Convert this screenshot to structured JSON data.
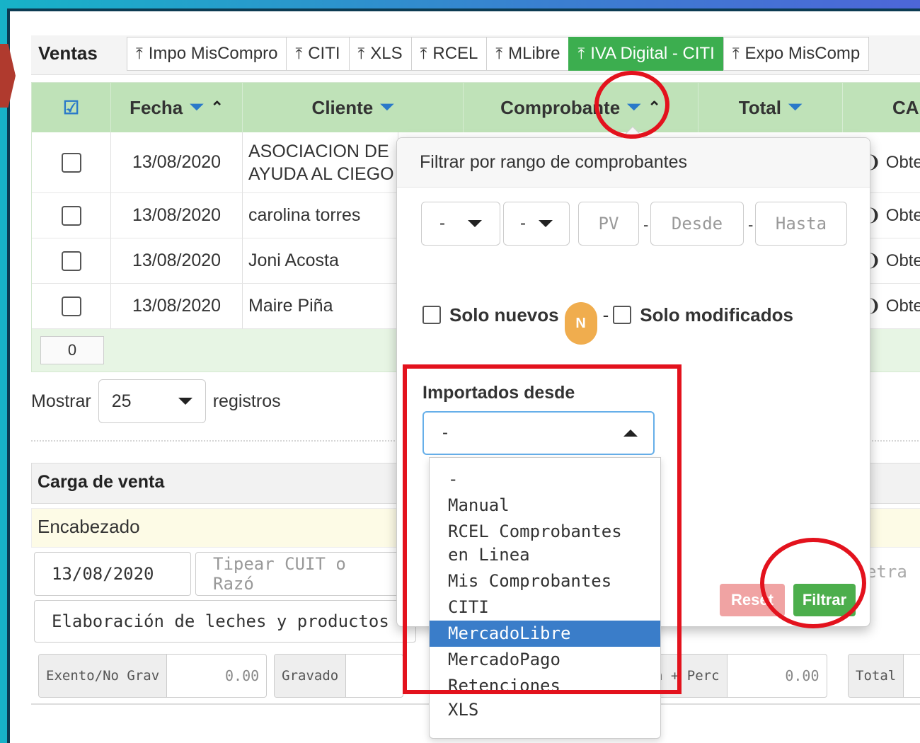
{
  "header": {
    "title": "Ventas",
    "tabs": [
      {
        "label": "Impo MisCompro",
        "active": false
      },
      {
        "label": "CITI",
        "active": false
      },
      {
        "label": "XLS",
        "active": false
      },
      {
        "label": "RCEL",
        "active": false
      },
      {
        "label": "MLibre",
        "active": false
      },
      {
        "label": "IVA Digital - CITI",
        "active": true
      },
      {
        "label": "Expo MisComp",
        "active": false
      }
    ]
  },
  "table": {
    "columns": [
      "Fecha",
      "Cliente",
      "Comprobante",
      "Total",
      "CAE"
    ],
    "rows": [
      {
        "fecha": "13/08/2020",
        "cliente": "ASOCIACION DE AYUDA AL CIEGO",
        "action": "Obte"
      },
      {
        "fecha": "13/08/2020",
        "cliente": "carolina torres",
        "action": "Obte"
      },
      {
        "fecha": "13/08/2020",
        "cliente": "Joni Acosta",
        "action": "Obte"
      },
      {
        "fecha": "13/08/2020",
        "cliente": "Maire Piña",
        "action": "Obte"
      }
    ],
    "selected_count": "0"
  },
  "pagination": {
    "show_label": "Mostrar",
    "page_size": "25",
    "records_label": "registros"
  },
  "form": {
    "section_title": "Carga de venta",
    "subsection": "Encabezado",
    "date_value": "13/08/2020",
    "cuit_placeholder": "Tipear CUIT o Razó",
    "activity_text": "Elaboración de leches y productos",
    "letra_placeholder": "etra",
    "totals": [
      {
        "label": "Exento/No Grav",
        "value": "0.00"
      },
      {
        "label": "Gravado",
        "value": ""
      },
      {
        "label": "n + Perc",
        "value": "0.00"
      },
      {
        "label": "Total",
        "value": ""
      }
    ]
  },
  "filter_popover": {
    "title": "Filtrar por rango de comprobantes",
    "select_type": "-",
    "select_letter": "-",
    "pv_placeholder": "PV",
    "desde_placeholder": "Desde",
    "hasta_placeholder": "Hasta",
    "solo_nuevos": "Solo nuevos",
    "badge": "N",
    "solo_modificados": "Solo modificados",
    "imported_label": "Importados desde",
    "imported_selected": "-",
    "reset_label": "Reset",
    "filter_label": "Filtrar"
  },
  "import_options": [
    "-",
    "Manual",
    "RCEL Comprobantes en Linea",
    "Mis Comprobantes",
    "CITI",
    "MercadoLibre",
    "MercadoPago",
    "Retenciones",
    "XLS"
  ],
  "highlighted_option": "MercadoLibre",
  "colors": {
    "accent_green": "#3cae4f",
    "filter_blue": "#2a79c9",
    "annotation_red": "#e3121d",
    "selected_blue": "#3a7dc9"
  }
}
